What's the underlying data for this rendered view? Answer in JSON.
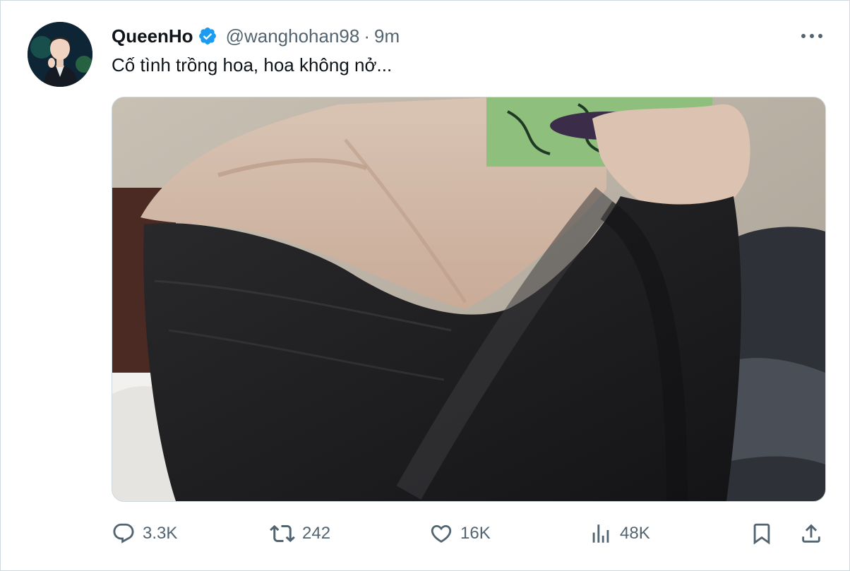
{
  "tweet": {
    "author": {
      "display_name": "QueenHo",
      "handle": "@wanghohan98",
      "verified": true,
      "avatar_icon": "user-avatar-photo"
    },
    "separator": "·",
    "time_ago": "9m",
    "text": "Cố tình trồng hoa, hoa không nở...",
    "media_icon": "photo-black-knit-sweater-mirror-selfie",
    "metrics": {
      "replies": "3.3K",
      "retweets": "242",
      "likes": "16K",
      "views": "48K"
    }
  },
  "colors": {
    "verified_blue": "#1d9bf0",
    "text_primary": "#0f1419",
    "text_secondary": "#536471",
    "border": "#cfd9de"
  }
}
